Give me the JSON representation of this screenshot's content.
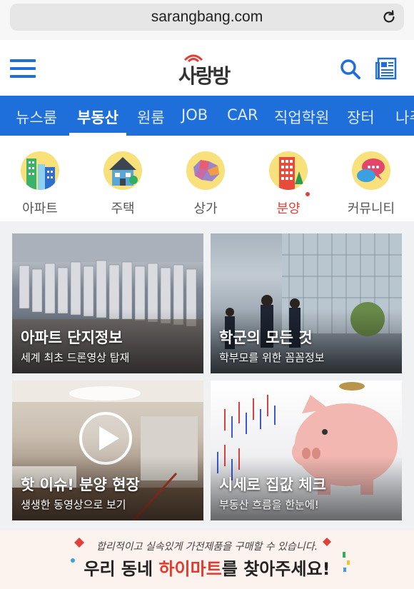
{
  "browser": {
    "url": "sarangbang.com"
  },
  "header": {
    "logo_text": "사랑방"
  },
  "nav": {
    "items": [
      {
        "label": "뉴스룸",
        "active": false
      },
      {
        "label": "부동산",
        "active": true
      },
      {
        "label": "원룸",
        "active": false
      },
      {
        "label": "JOB",
        "active": false
      },
      {
        "label": "CAR",
        "active": false
      },
      {
        "label": "직업학원",
        "active": false
      },
      {
        "label": "장터",
        "active": false
      },
      {
        "label": "나주",
        "active": false
      }
    ]
  },
  "categories": [
    {
      "label": "아파트",
      "icon": "apartment-icon"
    },
    {
      "label": "주택",
      "icon": "house-icon"
    },
    {
      "label": "상가",
      "icon": "map-icon"
    },
    {
      "label": "분양",
      "icon": "building-icon",
      "highlight": true
    },
    {
      "label": "커뮤니티",
      "icon": "chat-icon"
    }
  ],
  "cards": [
    {
      "title": "아파트 단지정보",
      "subtitle": "세계 최초 드론영상 탑재"
    },
    {
      "title": "학군의 모든 것",
      "subtitle": "학부모를 위한 꼼꼼정보"
    },
    {
      "title": "핫 이슈! 분양 현장",
      "subtitle": "생생한 동영상으로 보기"
    },
    {
      "title": "시세로 집값 체크",
      "subtitle": "부동산 흐름을 한눈에!"
    }
  ],
  "banner": {
    "subtitle": "합리적이고 실속있게 가전제품을 구매할 수 있습니다.",
    "main_prefix": "우리 동네 ",
    "main_highlight": "하이마트",
    "main_suffix": "를 찾아주세요!"
  },
  "colors": {
    "brand_blue": "#1e6fd9",
    "accent_red": "#e0403a"
  }
}
